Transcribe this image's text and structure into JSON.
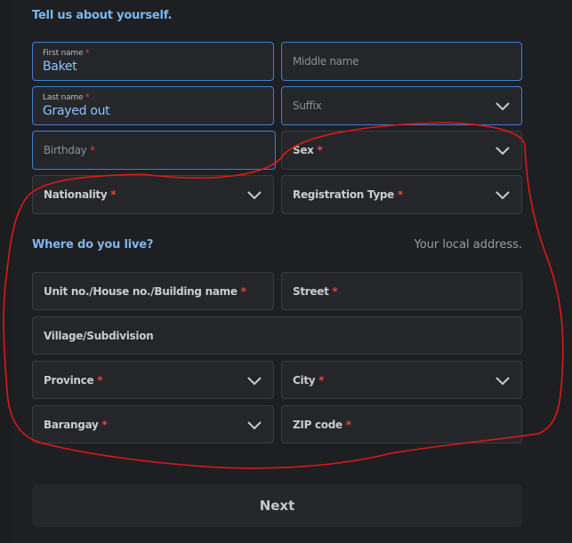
{
  "section1": {
    "title": "Tell us about yourself."
  },
  "fields": {
    "first_name": {
      "label": "First name",
      "value": "Baket"
    },
    "middle_name": {
      "placeholder": "Middle name"
    },
    "last_name": {
      "label": "Last name",
      "value": "Grayed out"
    },
    "suffix": {
      "placeholder": "Suffix"
    },
    "birthday": {
      "placeholder": "Birthday"
    },
    "sex": {
      "placeholder": "Sex"
    },
    "nationality": {
      "placeholder": "Nationality"
    },
    "registration_type": {
      "placeholder": "Registration Type"
    },
    "unit_no": {
      "placeholder": "Unit no./House no./Building name"
    },
    "street": {
      "placeholder": "Street"
    },
    "village": {
      "placeholder": "Village/Subdivision"
    },
    "province": {
      "placeholder": "Province"
    },
    "city": {
      "placeholder": "City"
    },
    "barangay": {
      "placeholder": "Barangay"
    },
    "zip": {
      "placeholder": "ZIP code"
    }
  },
  "section2": {
    "title": "Where do you live?",
    "hint": "Your local address."
  },
  "required_mark": "*",
  "next_button": {
    "label": "Next"
  },
  "colors": {
    "accent": "#7cb8f0",
    "required": "#e0443c",
    "annotation": "#e01818",
    "focus_border": "#3d7fd6"
  }
}
